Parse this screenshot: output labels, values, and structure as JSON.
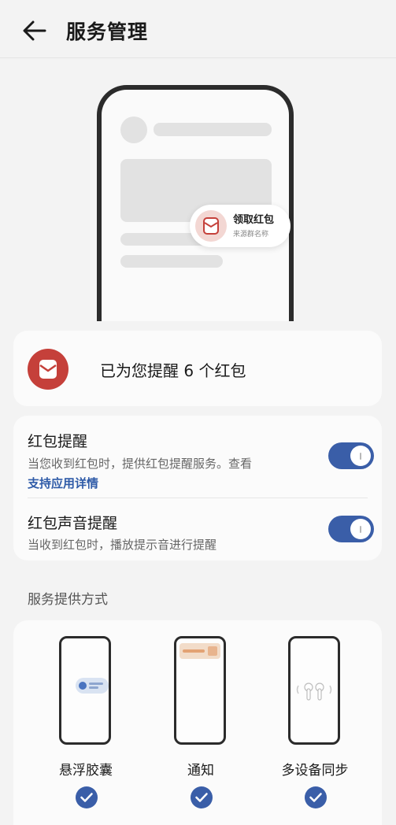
{
  "header": {
    "title": "服务管理",
    "back_icon": "arrow-left-icon"
  },
  "hero": {
    "popup_title": "领取红包",
    "popup_subtitle": "来源群名称",
    "popup_icon": "red-envelope-icon"
  },
  "summary": {
    "text": "已为您提醒 6 个红包",
    "icon": "red-envelope-icon"
  },
  "settings": [
    {
      "title": "红包提醒",
      "description": "当您收到红包时，提供红包提醒服务。查看",
      "link": "支持应用详情",
      "enabled": true
    },
    {
      "title": "红包声音提醒",
      "description": "当收到红包时，播放提示音进行提醒",
      "enabled": true
    }
  ],
  "methods_section": {
    "title": "服务提供方式",
    "items": [
      {
        "label": "悬浮胶囊",
        "selected": true
      },
      {
        "label": "通知",
        "selected": true
      },
      {
        "label": "多设备同步",
        "selected": true
      }
    ]
  },
  "colors": {
    "accent": "#3a5ea8",
    "red_envelope": "#c5403a",
    "link": "#2f5ba8",
    "background": "#f3f3f3"
  }
}
